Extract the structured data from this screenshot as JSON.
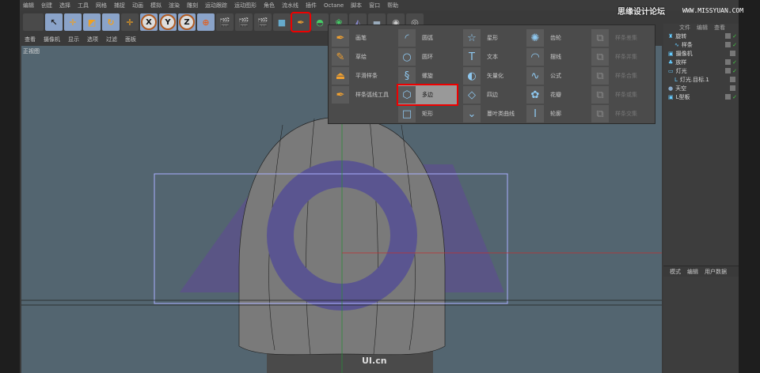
{
  "menu": [
    "编辑",
    "创建",
    "选择",
    "工具",
    "网格",
    "捕捉",
    "动画",
    "模拟",
    "渲染",
    "雕刻",
    "运动跟踪",
    "运动图形",
    "角色",
    "流水线",
    "插件",
    "Octane",
    "脚本",
    "窗口",
    "帮助"
  ],
  "toolbar": {
    "axes": [
      "X",
      "Y",
      "Z"
    ]
  },
  "view_menu": [
    "查看",
    "摄像机",
    "显示",
    "选项",
    "过滤",
    "面板"
  ],
  "viewport": {
    "label": "正视图",
    "watermark": "UI.cn"
  },
  "spline_menu": {
    "col1": [
      "画笔",
      "草绘",
      "平滑样条",
      "样条弧线工具"
    ],
    "col2": [
      "圆弧",
      "圆环",
      "螺旋",
      "多边",
      "矩形"
    ],
    "col3": [
      "星形",
      "文本",
      "矢量化",
      "四边",
      "蔓叶类曲线"
    ],
    "col4": [
      "齿轮",
      "摆线",
      "公式",
      "花瓣",
      "轮廓"
    ],
    "col5": [
      "样条差集",
      "样条并集",
      "样条合集",
      "样条或集",
      "样条交集"
    ],
    "selected": "多边"
  },
  "object_manager": {
    "header": [
      "文件",
      "编辑",
      "查看"
    ],
    "objects": [
      "旋转",
      "样条",
      "摄像机",
      "放样",
      "灯光",
      "灯光.目标.1",
      "天空",
      "L型板"
    ]
  },
  "attributes": {
    "tabs": [
      "模式",
      "编辑",
      "用户数据"
    ]
  },
  "site_watermark": {
    "cn": "思缘设计论坛",
    "url": "WWW.MISSYUAN.COM"
  },
  "colors": {
    "viewport": "#536570",
    "highlight": "#ee0000",
    "shape": "#5a4f8a"
  }
}
